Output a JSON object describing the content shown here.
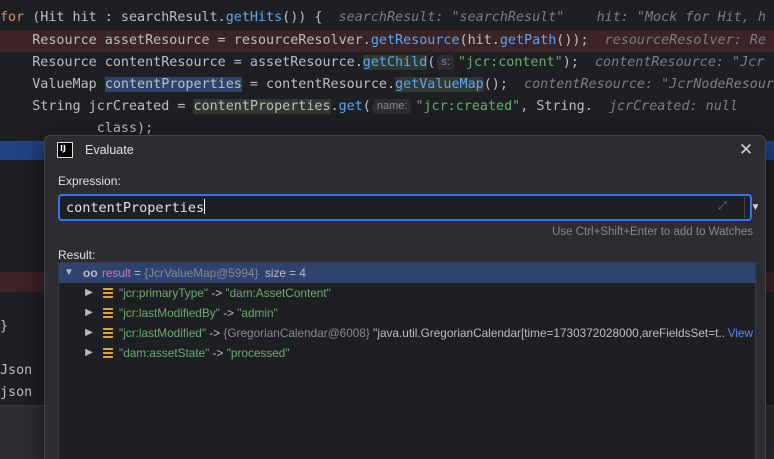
{
  "editor": {
    "line1": {
      "kw": "for",
      "a": " (Hit hit : searchResult.",
      "m": "getHits",
      "b": "()) {",
      "inline": "searchResult: \"searchResult\"    hit: \"Mock for Hit, h"
    },
    "line2": {
      "a": "    Resource assetResource = resourceResolver.",
      "m": "getResource",
      "b": "(hit.",
      "m2": "getPath",
      "c": "());",
      "inline": "resourceResolver: Re"
    },
    "line3": {
      "a": "    Resource contentResource = assetResource.",
      "m": "getChild",
      "b": "(",
      "hint": "s:",
      "s": "\"jcr:content\"",
      "c": ");",
      "inline": "contentResource: \"Jcr"
    },
    "line4": {
      "a": "    ValueMap ",
      "v": "contentProperties",
      "b": " = contentResource.",
      "m": "getValueMap",
      "c": "();",
      "inline": "contentResource: \"JcrNodeResour"
    },
    "line5": {
      "a": "    String jcrCreated = ",
      "v": "contentProperties",
      "b": ".",
      "m": "get",
      "c": "(",
      "hint": "name:",
      "s": "\"jcr:created\"",
      "d": ", String.",
      "inline": "jcrCreated: null"
    },
    "line6": {
      "a": "            class);"
    },
    "line7": {
      "a": "}"
    },
    "line8": {
      "a": "Json"
    },
    "line9": {
      "a": "json"
    }
  },
  "dialog": {
    "title": "Evaluate",
    "icon_text": "IJ",
    "expression_label": "Expression:",
    "expression_value": "contentProperties",
    "watch_hint": "Use Ctrl+Shift+Enter to add to Watches",
    "result_label": "Result:"
  },
  "result_tree": {
    "root": {
      "name": "result",
      "eq": " = ",
      "type": "{JcrValueMap@5994}",
      "size": "size = 4"
    },
    "entries": [
      {
        "key": "\"jcr:primaryType\"",
        "arrow": " -> ",
        "value": "\"dam:AssetContent\""
      },
      {
        "key": "\"jcr:lastModifiedBy\"",
        "arrow": " -> ",
        "value": "\"admin\""
      },
      {
        "key": "\"jcr:lastModified\"",
        "arrow": " -> ",
        "ref": "{GregorianCalendar@6008}",
        "value": " \"java.util.GregorianCalendar[time=1730372028000,areFieldsSet=t...",
        "link": "View"
      },
      {
        "key": "\"dam:assetState\"",
        "arrow": " -> ",
        "value": "\"processed\""
      }
    ]
  },
  "colors": {
    "accent": "#3574f0",
    "selection": "#2e436e",
    "field_icon": "#d9a343"
  }
}
